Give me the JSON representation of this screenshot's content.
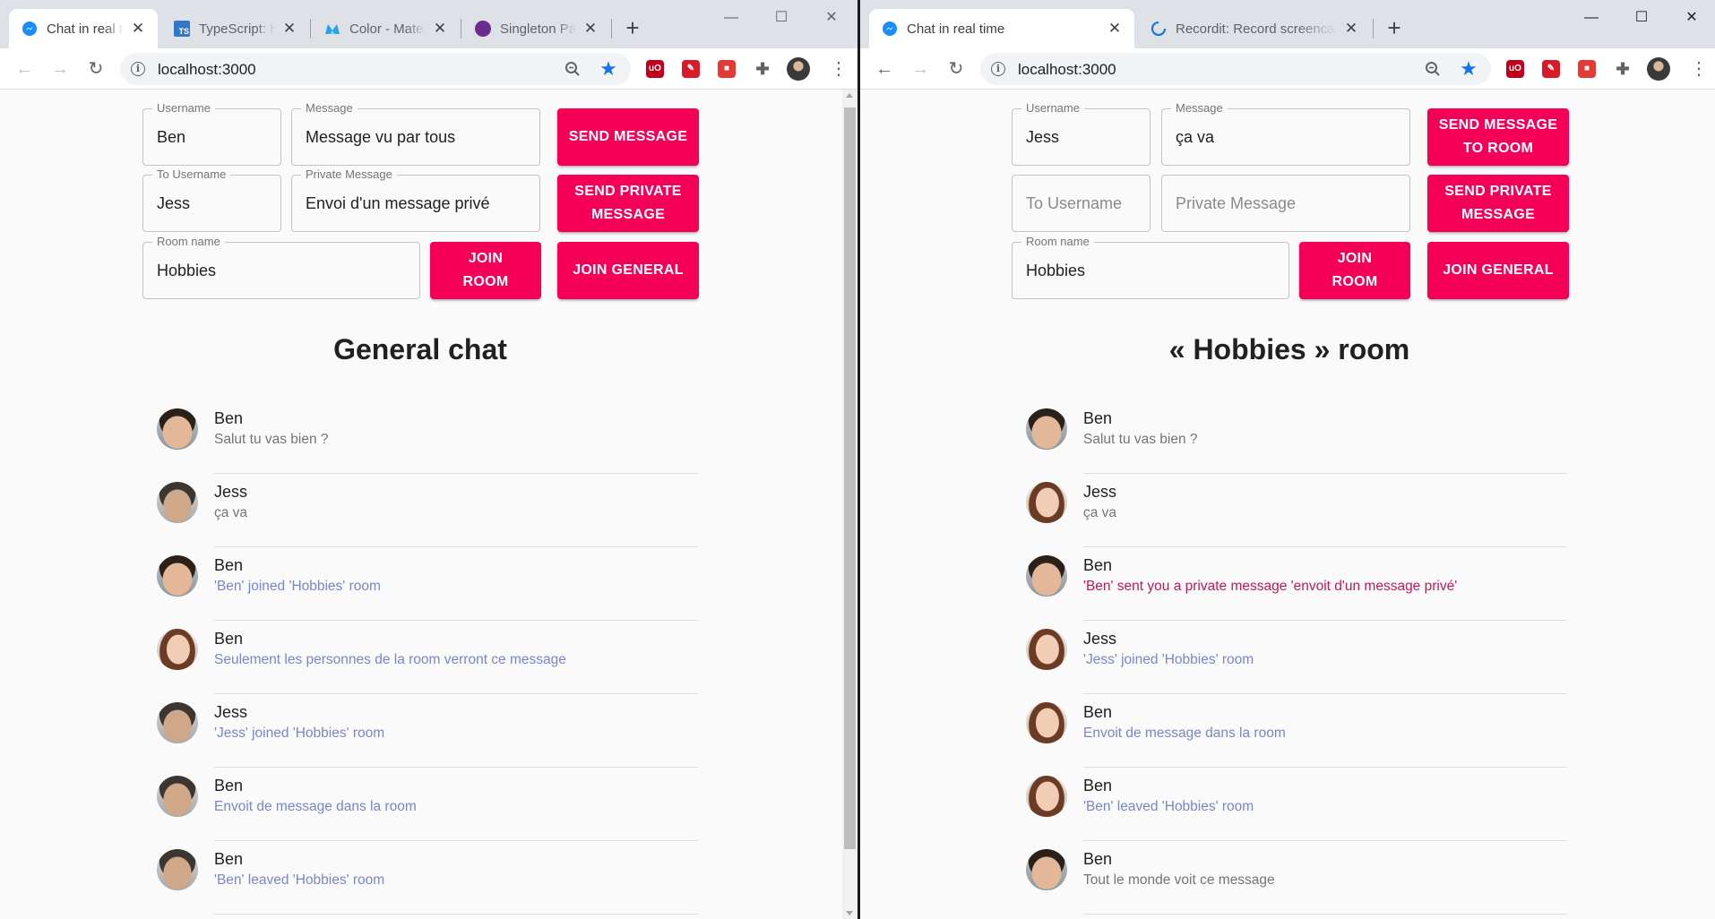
{
  "colors": {
    "accent": "#f50057",
    "info_text": "#7986cb",
    "private_text": "#c2185b",
    "star": "#1a73e8"
  },
  "left": {
    "tabs": [
      {
        "title": "Chat in real time",
        "icon": "messenger-icon"
      },
      {
        "title": "TypeScript: Handbook",
        "icon": "typescript-icon"
      },
      {
        "title": "Color - Material Design",
        "icon": "material-icon"
      },
      {
        "title": "Singleton Pattern",
        "icon": "circle-icon"
      }
    ],
    "url": "localhost:3000",
    "form": {
      "username_label": "Username",
      "username_value": "Ben",
      "message_label": "Message",
      "message_value": "Message vu par tous",
      "send_label": "SEND MESSAGE",
      "to_username_label": "To Username",
      "to_username_value": "Jess",
      "private_label": "Private Message",
      "private_value": "Envoi d'un message privé",
      "send_private_label": "SEND PRIVATE MESSAGE",
      "room_label": "Room name",
      "room_value": "Hobbies",
      "join_room_label": "JOIN ROOM",
      "join_general_label": "JOIN GENERAL"
    },
    "heading": "General chat",
    "messages": [
      {
        "name": "Ben",
        "text": "Salut tu vas bien ?",
        "avatar": "male",
        "kind": "normal"
      },
      {
        "name": "Jess",
        "text": "ça va",
        "avatar": "male2",
        "kind": "normal"
      },
      {
        "name": "Ben",
        "text": "'Ben' joined 'Hobbies' room",
        "avatar": "male",
        "kind": "info"
      },
      {
        "name": "Ben",
        "text": "Seulement les personnes de la room verront ce message",
        "avatar": "female",
        "kind": "info"
      },
      {
        "name": "Jess",
        "text": "'Jess' joined 'Hobbies' room",
        "avatar": "male2",
        "kind": "info"
      },
      {
        "name": "Ben",
        "text": "Envoit de message dans la room",
        "avatar": "male2",
        "kind": "info"
      },
      {
        "name": "Ben",
        "text": "'Ben' leaved 'Hobbies' room",
        "avatar": "male2",
        "kind": "info"
      }
    ]
  },
  "right": {
    "tabs": [
      {
        "title": "Chat in real time",
        "icon": "messenger-icon"
      },
      {
        "title": "Recordit: Record screencasts fast & free!",
        "icon": "loading-icon"
      }
    ],
    "url": "localhost:3000",
    "form": {
      "username_label": "Username",
      "username_value": "Jess",
      "message_label": "Message",
      "message_value": "ça va",
      "send_label": "SEND MESSAGE TO ROOM",
      "to_username_placeholder": "To Username",
      "private_placeholder": "Private Message",
      "send_private_label": "SEND PRIVATE MESSAGE",
      "room_label": "Room name",
      "room_value": "Hobbies",
      "join_room_label": "JOIN ROOM",
      "join_general_label": "JOIN GENERAL"
    },
    "heading": "« Hobbies » room",
    "messages": [
      {
        "name": "Ben",
        "text": "Salut tu vas bien ?",
        "avatar": "male",
        "kind": "normal"
      },
      {
        "name": "Jess",
        "text": "ça va",
        "avatar": "female",
        "kind": "normal"
      },
      {
        "name": "Ben",
        "text": "'Ben' sent you a private message 'envoit d'un message privé'",
        "avatar": "male",
        "kind": "private"
      },
      {
        "name": "Jess",
        "text": "'Jess' joined 'Hobbies' room",
        "avatar": "female",
        "kind": "info"
      },
      {
        "name": "Ben",
        "text": "Envoit de message dans la room",
        "avatar": "female",
        "kind": "info"
      },
      {
        "name": "Ben",
        "text": "'Ben' leaved 'Hobbies' room",
        "avatar": "female",
        "kind": "info"
      },
      {
        "name": "Ben",
        "text": "Tout le monde voit ce message",
        "avatar": "male",
        "kind": "normal"
      }
    ]
  }
}
